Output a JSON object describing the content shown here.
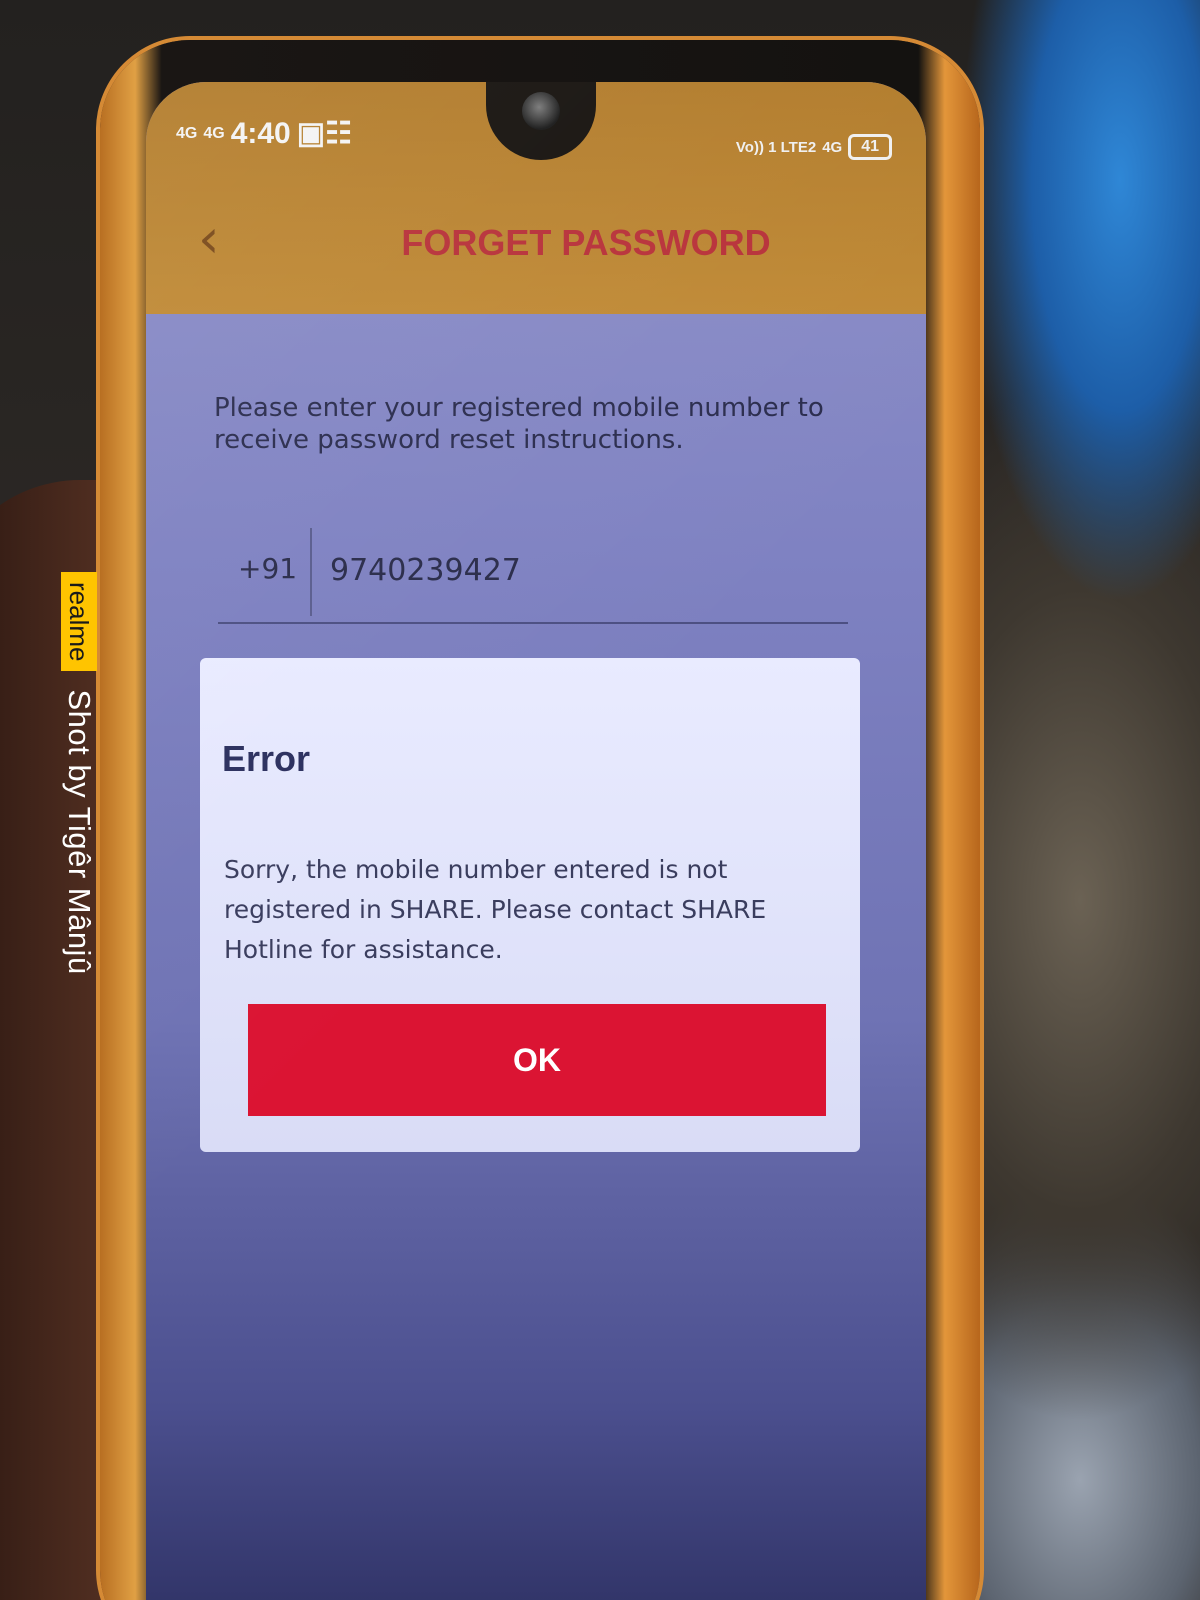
{
  "status_bar": {
    "signal_1": "4G",
    "signal_2": "4G",
    "time": "4:40",
    "right_network": "Vo)) 1 LTE2",
    "right_4g": "4G",
    "battery": "41"
  },
  "header": {
    "title": "FORGET PASSWORD",
    "back_icon": "chevron-left-icon"
  },
  "form": {
    "instructions": "Please enter your registered mobile number to receive password reset instructions.",
    "country_code": "+91",
    "mobile_number": "9740239427"
  },
  "dialog": {
    "title": "Error",
    "message": "Sorry, the mobile number entered is not registered in SHARE. Please contact SHARE Hotline for assistance.",
    "ok_label": "OK"
  },
  "watermark": {
    "brand": "realme",
    "text": "Shot by Tigêr Mânjû"
  },
  "colors": {
    "header_bg": "#c08a36",
    "title_red": "#b8323a",
    "ok_button": "#db1433",
    "dialog_text": "#2b2f5e"
  }
}
